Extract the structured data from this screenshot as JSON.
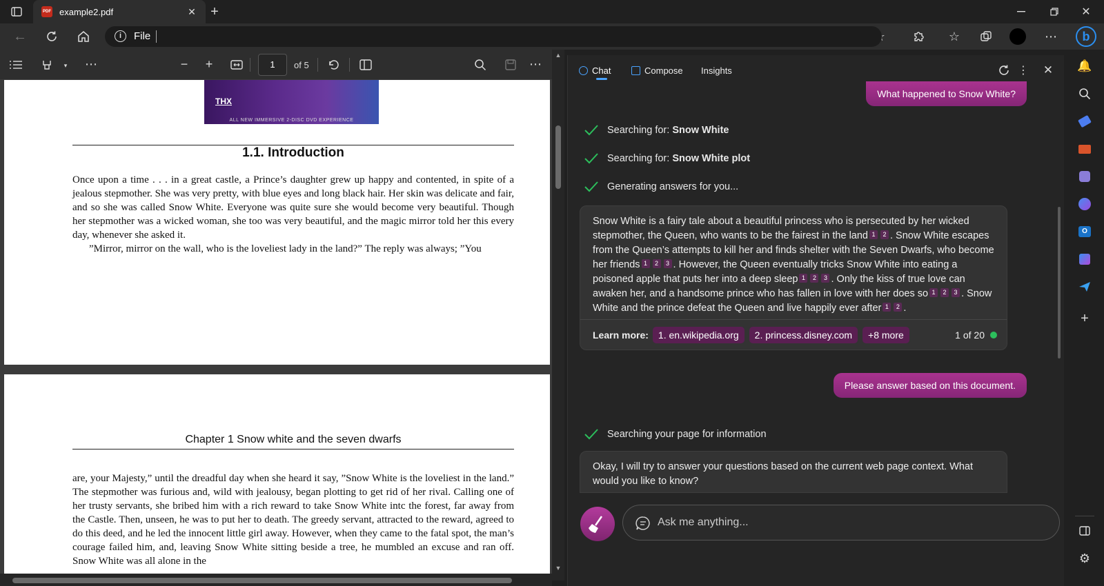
{
  "browser": {
    "tab_title": "example2.pdf",
    "address_label": "File"
  },
  "pdf_toolbar": {
    "page_current": "1",
    "page_total": "of 5"
  },
  "document": {
    "banner_text": "ALL NEW IMMERSIVE 2-DISC DVD EXPERIENCE",
    "section_heading": "1.1.  Introduction",
    "para1": "Once upon a time . . . in a great castle, a Prince’s daughter grew up happy and contented, in spite of a jealous stepmother. She was very pretty, with blue eyes and long black hair. Her skin was delicate and fair, and so she was called Snow White. Everyone was quite sure she would become very beautiful. Though her stepmother was a wicked woman, she too was very beautiful, and the magic mirror told her this every day, whenever she asked it.",
    "para2": "”Mirror, mirror on the wall, who is the loveliest lady in the land?” The reply was always; ”You",
    "chapter_heading": "Chapter 1 Snow white and the seven dwarfs",
    "para3": "are, your Majesty,” until the dreadful day when she heard it say, ”Snow White is the loveliest in the land.” The stepmother was furious and, wild with jealousy, began plotting to get rid of her rival. Calling one of her trusty servants, she bribed him with a rich reward to take Snow White intc the forest, far away from the Castle. Then, unseen, he was to put her to death. The greedy servant, attracted to the reward, agreed to do this deed, and he led the innocent little girl away. However, when they came to the fatal spot, the man’s courage failed him, and, leaving Snow White sitting beside a tree, he mumbled an excuse and ran off. Snow White was all alone in the"
  },
  "chat": {
    "tabs": [
      "Chat",
      "Compose",
      "Insights"
    ],
    "user_msg1": "What happened to Snow White?",
    "status1_prefix": "Searching for: ",
    "status1_bold": "Snow White",
    "status2_prefix": "Searching for: ",
    "status2_bold": "Snow White plot",
    "status3": "Generating answers for you...",
    "answer_parts": [
      "Snow White is a fairy tale about a beautiful princess who is persecuted by her wicked stepmother, the Queen, who wants to be the fairest in the land",
      ". Snow White escapes from the Queen’s attempts to kill her and finds shelter with the Seven Dwarfs, who become her friends",
      ". However, the Queen eventually tricks Snow White into eating a poisoned apple that puts her into a deep sleep",
      ". Only the kiss of true love can awaken her, and a handsome prince who has fallen in love with her does so",
      ". Snow White and the prince defeat the Queen and live happily ever after",
      "."
    ],
    "learn_more_label": "Learn more:",
    "sources": [
      "1. en.wikipedia.org",
      "2. princess.disney.com",
      "+8 more"
    ],
    "response_count": "1 of 20",
    "user_msg2": "Please answer based on this document.",
    "status4": "Searching your page for information",
    "answer2": "Okay, I will try to answer your questions based on the current web page context. What would you like to know?",
    "input_placeholder": "Ask me anything..."
  },
  "colors": {
    "accent": "#9c2a8c",
    "check_green": "#2cbf5c"
  }
}
